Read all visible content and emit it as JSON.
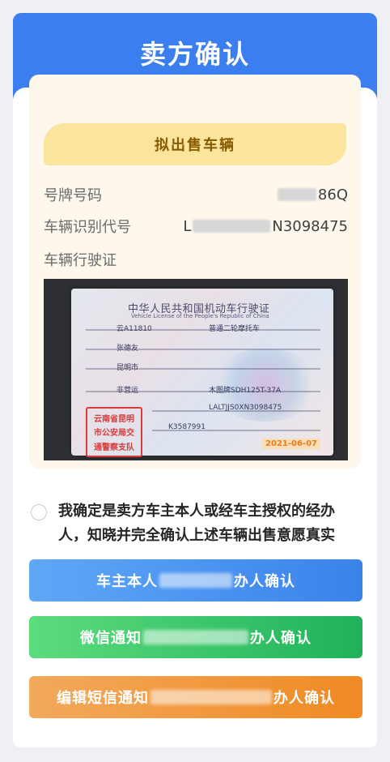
{
  "header": {
    "title": "卖方确认"
  },
  "vehicle_card": {
    "ribbon_label": "拟出售车辆",
    "plate": {
      "label": "号牌号码",
      "value_suffix": "86Q"
    },
    "vin": {
      "label": "车辆识别代号",
      "value_prefix": "L",
      "value_suffix": "N3098475"
    },
    "license_label": "车辆行驶证"
  },
  "license_image": {
    "title": "中华人民共和国机动车行驶证",
    "subtitle": "Vehicle License of the People's Republic of China",
    "fields": [
      "云A11810",
      "普通二轮摩托车",
      "张德友",
      "昆明市",
      "非营运",
      "木图牌SDH125T-37A",
      "LALTJJS0XN3098475",
      "K3587991"
    ],
    "stamp_lines": [
      "云南省昆明",
      "市公安局交",
      "通警察支队"
    ],
    "date": "2021-06-07"
  },
  "confirmation": {
    "text": "我确定是卖方车主本人或经车主授权的经办人，知晓并完全确认上述车辆出售意愿真实"
  },
  "buttons": {
    "owner_prefix": "车主本人",
    "owner_suffix": "办人确认",
    "wechat_prefix": "微信通知",
    "wechat_suffix": "办人确认",
    "sms_prefix": "编辑短信通知",
    "sms_suffix": "办人确认"
  },
  "colors": {
    "header": "#3b7ef0",
    "ribbon": "#fbe49b",
    "card": "#fdf7ec",
    "blue_button": "#3a82ea",
    "green_button": "#1fb25a",
    "orange_button": "#f08a23"
  }
}
